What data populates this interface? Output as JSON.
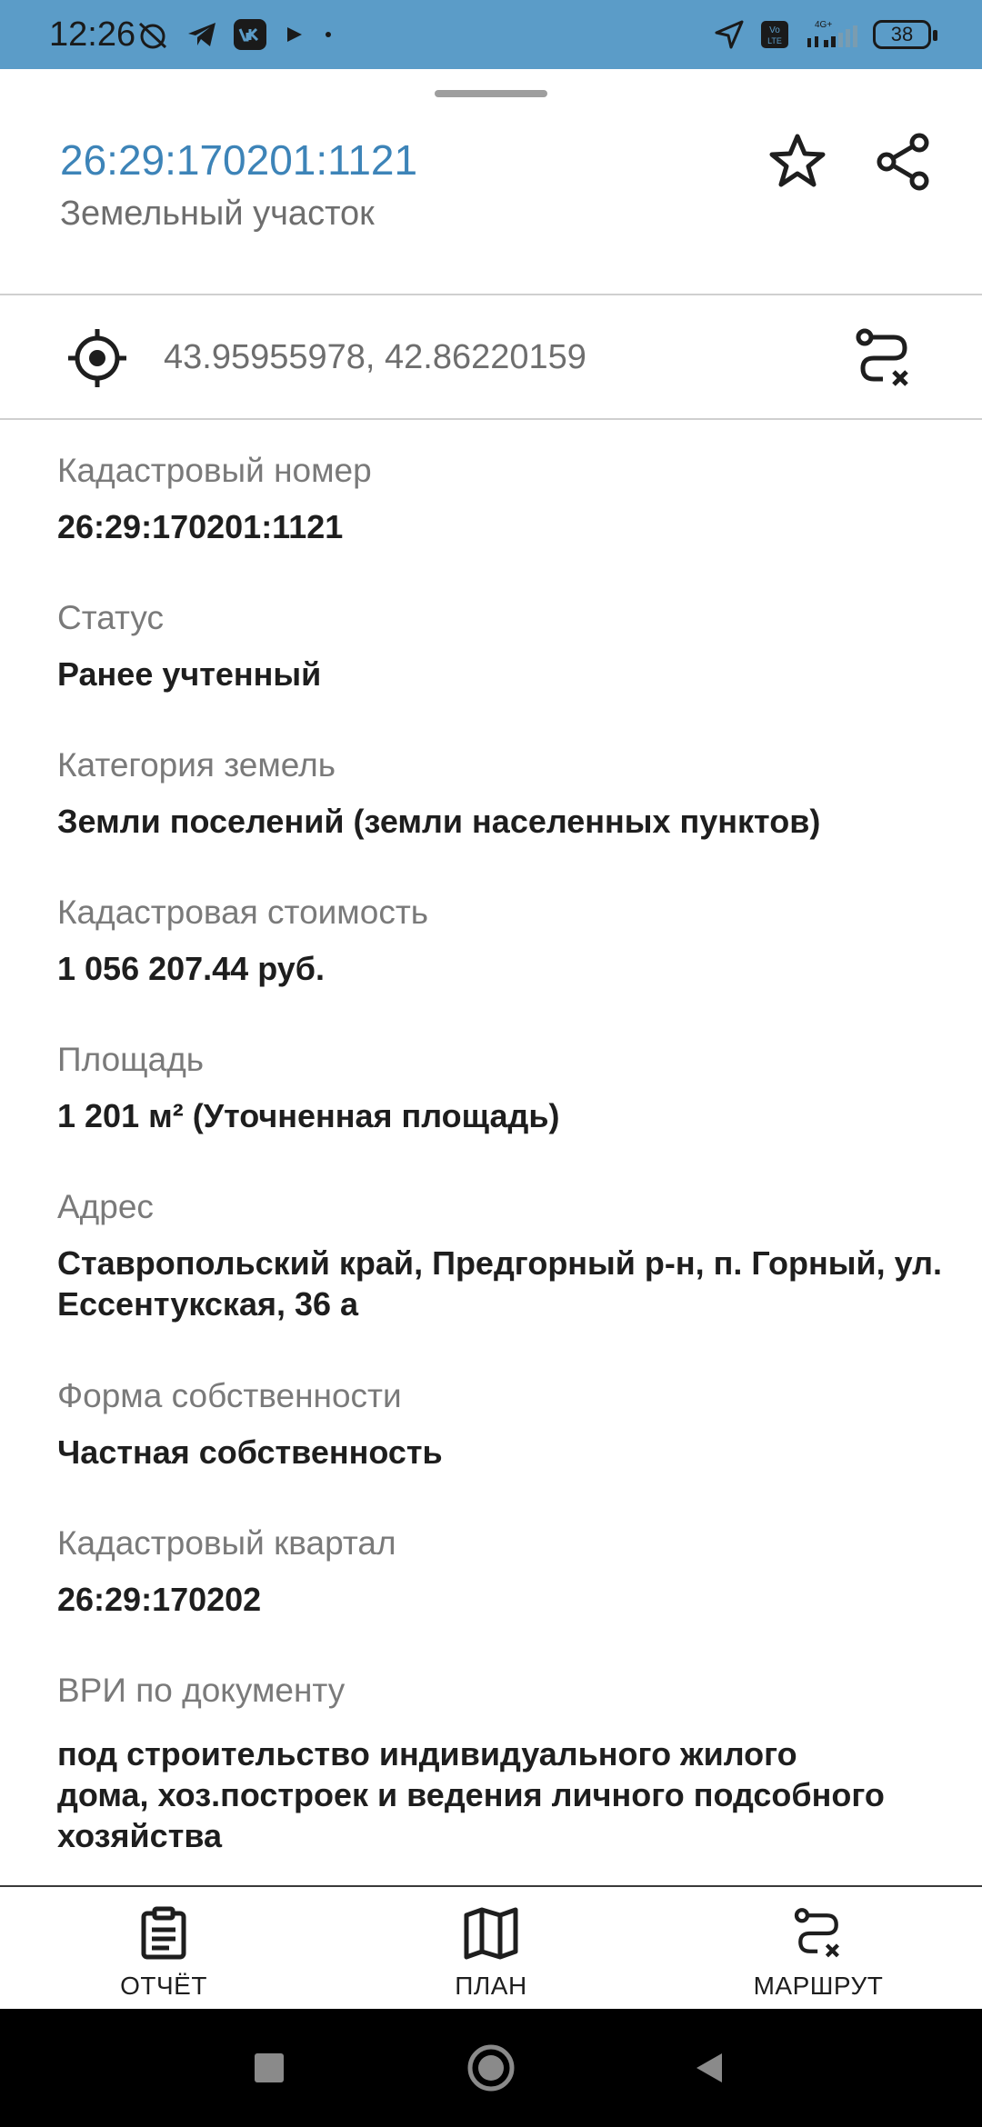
{
  "status_bar": {
    "time": "12:26",
    "battery": "38",
    "network": "4G+",
    "volte": "VoLTE"
  },
  "header": {
    "title": "26:29:170201:1121",
    "subtitle": "Земельный участок"
  },
  "coordinates": {
    "text": "43.95955978, 42.86220159"
  },
  "fields": [
    {
      "label": "Кадастровый номер",
      "value": "26:29:170201:1121"
    },
    {
      "label": "Статус",
      "value": "Ранее учтенный"
    },
    {
      "label": "Категория земель",
      "value": "Земли поселений (земли населенных пунктов)"
    },
    {
      "label": "Кадастровая стоимость",
      "value": "1 056 207.44 руб."
    },
    {
      "label": "Площадь",
      "value": "1 201 м² (Уточненная площадь)"
    },
    {
      "label": "Адрес",
      "value_lines": [
        "Ставропольский край, Предгорный р-н, п. Горный, ул.",
        "Ессентукская, 36 а"
      ]
    },
    {
      "label": "Форма собственности",
      "value": "Частная собственность"
    },
    {
      "label": "Кадастровый квартал",
      "value": "26:29:170202"
    },
    {
      "label": "ВРИ по документу",
      "value_lines": [
        "под строительство индивидуального жилого",
        "дома, хоз.построек и ведения личного подсобного",
        "хозяйства"
      ]
    }
  ],
  "bottom_nav": {
    "report_label": "ОТЧЁТ",
    "plan_label": "ПЛАН",
    "route_label": "МАРШРУТ"
  },
  "colors": {
    "status_bar": "#5b9cc8",
    "title_accent": "#3d84b8"
  },
  "icons": {
    "header": [
      "star-icon",
      "share-icon"
    ],
    "coordinates": [
      "crosshair-icon",
      "route-clear-icon"
    ],
    "bottom_nav": [
      "clipboard-icon",
      "map-icon",
      "route-clear-icon"
    ]
  }
}
